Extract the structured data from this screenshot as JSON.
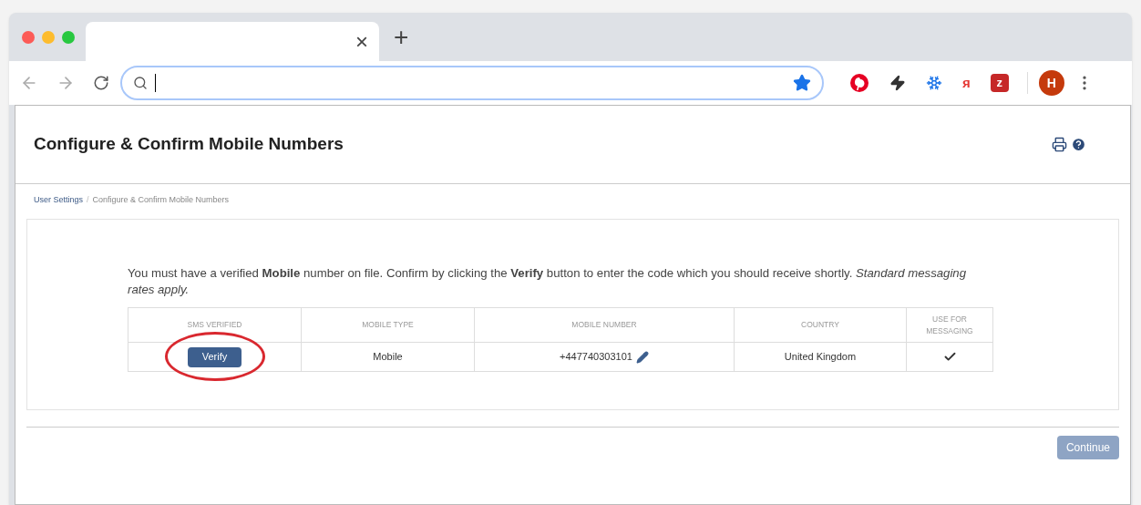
{
  "browser": {
    "tab": {
      "close": "×"
    },
    "new_tab": "+",
    "address": {
      "bookmarked": true
    },
    "extensions": [
      {
        "kind": "pinterest"
      },
      {
        "kind": "bolt"
      },
      {
        "kind": "snowflake"
      },
      {
        "kind": "letter",
        "text": "я"
      },
      {
        "kind": "badge",
        "text": "z"
      }
    ],
    "avatar": "H"
  },
  "page": {
    "title": "Configure & Confirm Mobile Numbers",
    "breadcrumb_separator": "/",
    "breadcrumbs": [
      {
        "label": "User Settings",
        "link": true
      },
      {
        "label": "Configure & Confirm Mobile Numbers",
        "link": false
      }
    ],
    "notice": "You must have a verified **Mobile** number on file. Confirm by clicking the **Verify** button to enter the code which you should receive shortly. *Standard messaging rates apply.*",
    "table": {
      "columns": [
        "SMS VERIFIED",
        "MOBILE TYPE",
        "MOBILE NUMBER",
        "COUNTRY",
        "USE FOR MESSAGING"
      ],
      "rows": [
        {
          "action": "Verify",
          "highlighted": true,
          "mobile_type": "Mobile",
          "mobile_number": "+447740303101",
          "country": "United Kingdom",
          "use_for_messaging": true
        }
      ]
    },
    "continue": {
      "label": "Continue",
      "disabled": true
    }
  }
}
